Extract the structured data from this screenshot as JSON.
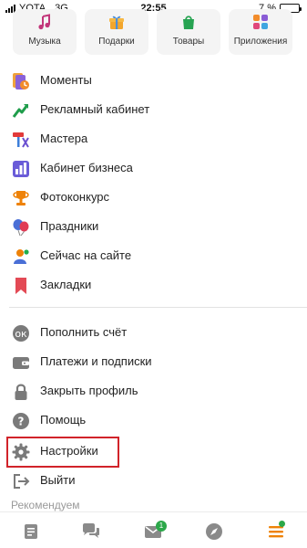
{
  "status": {
    "carrier": "YOTA",
    "network": "3G",
    "time": "22:55",
    "battery": "7 %",
    "battery_level": 0.07
  },
  "tiles": [
    {
      "label": "Музыка",
      "icon": "music-icon"
    },
    {
      "label": "Подарки",
      "icon": "gift-icon"
    },
    {
      "label": "Товары",
      "icon": "shopping-bag-icon"
    },
    {
      "label": "Приложения",
      "icon": "apps-icon"
    }
  ],
  "menu": {
    "section1": [
      {
        "label": "Моменты",
        "icon": "moments-icon"
      },
      {
        "label": "Рекламный кабинет",
        "icon": "ads-chart-icon"
      },
      {
        "label": "Мастера",
        "icon": "masters-tools-icon"
      },
      {
        "label": "Кабинет бизнеса",
        "icon": "business-bars-icon"
      },
      {
        "label": "Фотоконкурс",
        "icon": "trophy-icon"
      },
      {
        "label": "Праздники",
        "icon": "balloons-icon"
      },
      {
        "label": "Сейчас на сайте",
        "icon": "online-users-icon"
      },
      {
        "label": "Закладки",
        "icon": "bookmark-icon"
      }
    ],
    "section2": [
      {
        "label": "Пополнить счёт",
        "icon": "top-up-coin-icon"
      },
      {
        "label": "Платежи и подписки",
        "icon": "wallet-icon"
      },
      {
        "label": "Закрыть профиль",
        "icon": "lock-icon"
      },
      {
        "label": "Помощь",
        "icon": "help-icon"
      },
      {
        "label": "Настройки",
        "icon": "gear-icon"
      },
      {
        "label": "Выйти",
        "icon": "logout-icon"
      }
    ],
    "recommend_label": "Рекомендуем"
  },
  "bottom_bar": {
    "messages_badge": "1"
  },
  "colors": {
    "highlight": "#d1232a",
    "accent_green": "#2ca84a",
    "orange": "#ee8208"
  }
}
